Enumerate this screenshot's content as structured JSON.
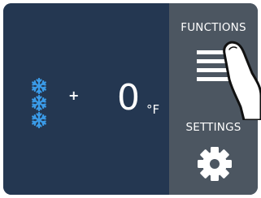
{
  "display": {
    "plus_sign": "+",
    "temperature_value": "0",
    "temperature_unit": "°F",
    "mode_icon": "snowflake-icon",
    "mode_icon_count": 3
  },
  "side_panel": {
    "functions_label": "FUNCTIONS",
    "functions_icon": "hamburger-menu-icon",
    "settings_label": "SETTINGS",
    "settings_icon": "gear-icon"
  },
  "colors": {
    "display_background": "#243751",
    "panel_background": "#4c5661",
    "snowflake": "#3a9be8",
    "text": "#ffffff"
  }
}
